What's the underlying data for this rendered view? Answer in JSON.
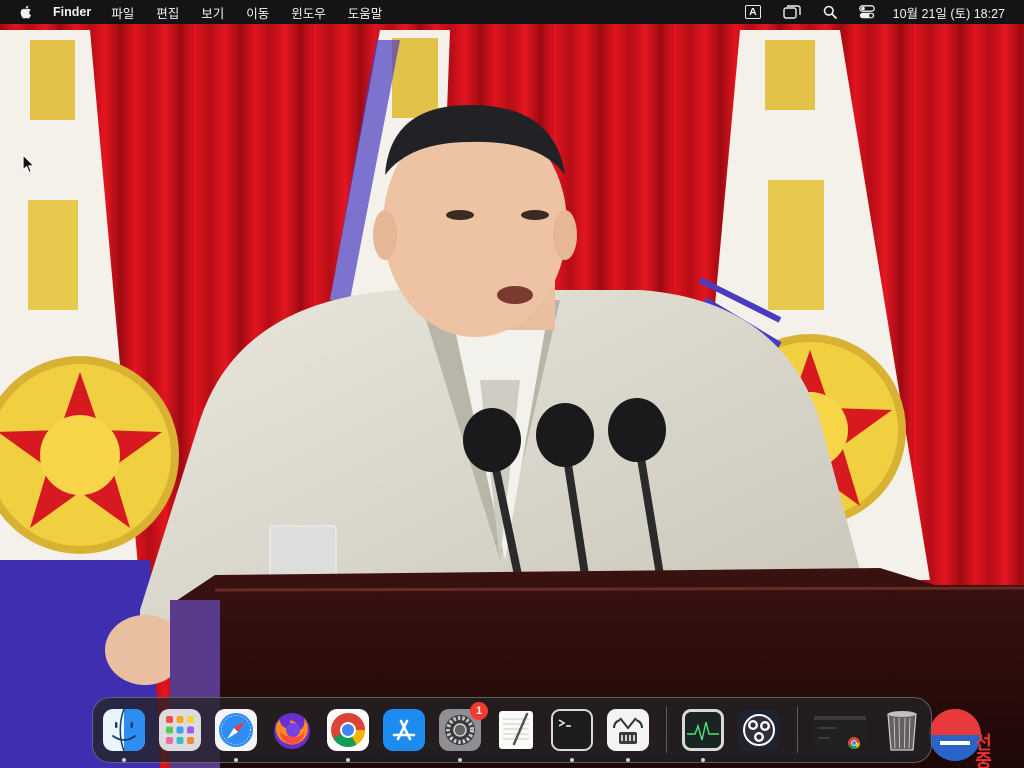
{
  "menubar": {
    "app_name": "Finder",
    "menus": [
      "파일",
      "편집",
      "보기",
      "이동",
      "윈도우",
      "도움말"
    ],
    "input_source": "A",
    "clock": "10월 21일 (토) 18:27"
  },
  "dock": {
    "apps": [
      {
        "name": "Finder",
        "icon": "finder-icon",
        "running": true
      },
      {
        "name": "Launchpad",
        "icon": "launchpad-icon",
        "running": false
      },
      {
        "name": "Safari",
        "icon": "safari-icon",
        "running": true
      },
      {
        "name": "Firefox",
        "icon": "firefox-icon",
        "running": false
      },
      {
        "name": "Google Chrome",
        "icon": "chrome-icon",
        "running": true
      },
      {
        "name": "App Store",
        "icon": "app-store-icon",
        "running": false
      },
      {
        "name": "System Settings",
        "icon": "system-settings-icon",
        "running": true,
        "badge": "1"
      },
      {
        "name": "TextEdit",
        "icon": "textedit-icon",
        "running": false
      },
      {
        "name": "Terminal",
        "icon": "terminal-icon",
        "running": true
      },
      {
        "name": "Archive Utility",
        "icon": "archive-utility-icon",
        "running": true
      },
      {
        "name": "Activity Monitor",
        "icon": "activity-monitor-icon",
        "running": true
      },
      {
        "name": "OBS",
        "icon": "obs-icon",
        "running": false
      },
      {
        "name": "Chrome window",
        "icon": "minimized-window-icon",
        "running": false
      },
      {
        "name": "Trash",
        "icon": "trash-icon",
        "running": false
      }
    ]
  },
  "wallpaper": {
    "overlay_text": "선중앙"
  },
  "colors": {
    "menubar_bg": "#141414",
    "curtain_red": "#c8101a",
    "flag_gold": "#e6c53a",
    "badge_red": "#f23a2f"
  }
}
